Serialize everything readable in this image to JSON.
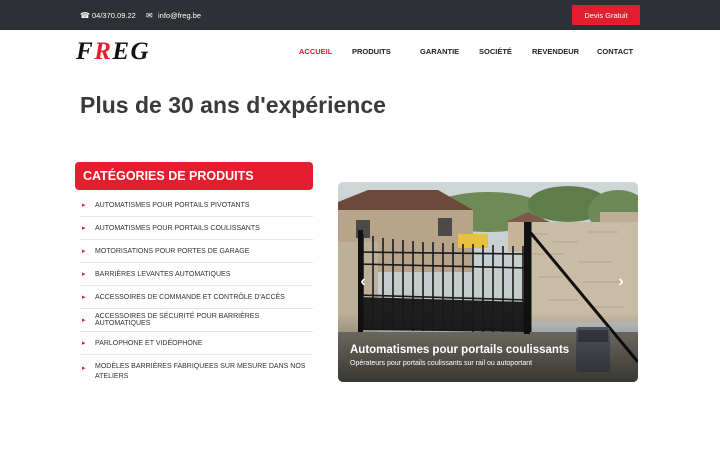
{
  "topbar": {
    "phone": "04/370.09.22",
    "email": "info@freg.be",
    "devis_label": "Devis Gratuit",
    "phone_icon": "phone-icon",
    "email_icon": "envelope-icon"
  },
  "logo": {
    "prefix": "F",
    "accent": "R",
    "suffix": "EG"
  },
  "nav": {
    "accueil": "ACCUEIL",
    "produits": "PRODUITS",
    "garantie": "GARANTIE",
    "societe": "SOCIÉTÉ",
    "revendeur": "REVENDEUR",
    "contact": "CONTACT"
  },
  "headline": "Plus de 30 ans d'expérience",
  "categories": {
    "title": "CATÉGORIES DE PRODUITS",
    "items": [
      "AUTOMATISMES POUR PORTAILS PIVOTANTS",
      "AUTOMATISMES POUR PORTAILS COULISSANTS",
      "MOTORISATIONS POUR PORTES DE GARAGE",
      "BARRIÈRES LEVANTES AUTOMATIQUES",
      "ACCESSOIRES DE COMMANDE ET CONTRÔLE D'ACCÈS",
      "ACCESSOIRES DE SÉCURITÉ POUR BARRIÈRES AUTOMATIQUES",
      "PARLOPHONE ET VIDÉOPHONE",
      "MODÈLES BARRIÈRES FABRIQUEES SUR MESURE DANS NOS ATELIERS"
    ]
  },
  "slider": {
    "title": "Automatismes pour portails coulissants",
    "subtitle": "Opérateurs pour portails coulissants sur rail ou autoportant",
    "prev_icon": "chevron-left-icon",
    "next_icon": "chevron-right-icon"
  },
  "colors": {
    "accent": "#e31e2f",
    "topbar": "#2d3035"
  }
}
